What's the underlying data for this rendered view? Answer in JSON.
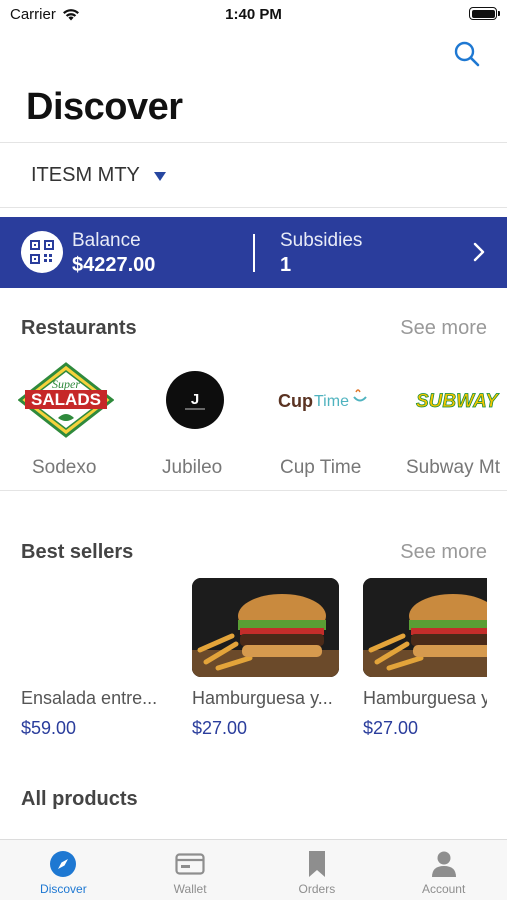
{
  "status_bar": {
    "carrier": "Carrier",
    "time": "1:40 PM"
  },
  "header": {
    "title": "Discover"
  },
  "campus": {
    "name": "ITESM MTY"
  },
  "balance": {
    "label": "Balance",
    "value": "$4227.00",
    "subsidies_label": "Subsidies",
    "subsidies_value": "1"
  },
  "restaurants": {
    "title": "Restaurants",
    "see_more": "See more",
    "items": [
      {
        "name": "Sodexo",
        "logo_text_top": "Super",
        "logo_text_main": "SALADS"
      },
      {
        "name": "Jubileo",
        "logo_text_main": "J"
      },
      {
        "name": "Cup Time",
        "logo_text_main": "Cup",
        "logo_text_accent": "Time"
      },
      {
        "name": "Subway Mt",
        "logo_text_main": "SUBWAY"
      }
    ]
  },
  "best_sellers": {
    "title": "Best sellers",
    "see_more": "See more",
    "items": [
      {
        "name": "Ensalada entre...",
        "price": "$59.00",
        "has_image": false
      },
      {
        "name": "Hamburguesa y...",
        "price": "$27.00",
        "has_image": true
      },
      {
        "name": "Hamburguesa y",
        "price": "$27.00",
        "has_image": true
      }
    ]
  },
  "all_products": {
    "title": "All products"
  },
  "tabs": [
    {
      "label": "Discover",
      "icon": "compass-icon",
      "active": true
    },
    {
      "label": "Wallet",
      "icon": "wallet-icon",
      "active": false
    },
    {
      "label": "Orders",
      "icon": "bookmark-icon",
      "active": false
    },
    {
      "label": "Account",
      "icon": "person-icon",
      "active": false
    }
  ],
  "colors": {
    "primary": "#2a3d9c",
    "tab_active": "#1e78d2",
    "caret": "#2747a0"
  }
}
